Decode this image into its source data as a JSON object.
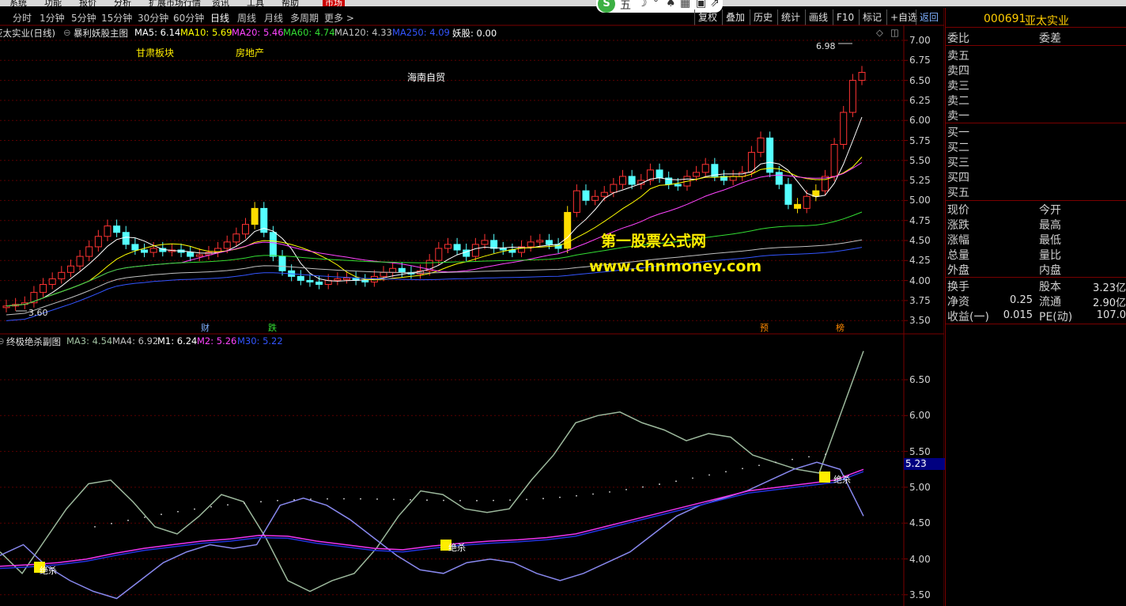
{
  "menu": {
    "items": [
      "系统",
      "功能",
      "报价",
      "分析",
      "扩展市场行情",
      "资讯",
      "工具",
      "帮助",
      "市场"
    ]
  },
  "periods": [
    "分时",
    "1分钟",
    "5分钟",
    "15分钟",
    "30分钟",
    "60分钟",
    "日线",
    "周线",
    "月线",
    "多周期",
    "更多 >"
  ],
  "active_period": "日线",
  "toolbar": [
    "复权",
    "叠加",
    "历史",
    "统计",
    "画线",
    "F10",
    "标记",
    "+自选"
  ],
  "toolbar_return": "返回",
  "search": {
    "logo": "S",
    "glyphs": [
      "五",
      "☽",
      "°",
      "♠",
      "▦",
      "▣",
      "⇗"
    ]
  },
  "main_header": {
    "title": "亚太实业(日线)",
    "formula": "暴利妖股主图",
    "ma": [
      {
        "label": "MA5: 6.14",
        "color": "#ffffff"
      },
      {
        "label": "MA10: 5.69",
        "color": "#ffff00"
      },
      {
        "label": "MA20: 5.46",
        "color": "#ff44ff"
      },
      {
        "label": "MA60: 4.74",
        "color": "#33dd33"
      },
      {
        "label": "MA120: 4.33",
        "color": "#c0c0c0"
      },
      {
        "label": "MA250: 4.09",
        "color": "#3355ff"
      },
      {
        "label": "妖股: 0.00",
        "color": "#ffffff"
      }
    ]
  },
  "annotations": {
    "board": "甘肃板块",
    "realestate": "房地产",
    "hainan": "海南自贸",
    "high": "6.98",
    "low": "3.60"
  },
  "event_tags": [
    "财",
    "跌",
    "预",
    "榜"
  ],
  "sub_header": {
    "formula": "终极绝杀副图",
    "items": [
      {
        "label": "MA3: 4.54",
        "color": "#a0c0a0"
      },
      {
        "label": "MA4: 6.92",
        "color": "#c0c0c0"
      },
      {
        "label": "M1: 6.24",
        "color": "#ffffff"
      },
      {
        "label": "M2: 5.26",
        "color": "#ff44ff"
      },
      {
        "label": "M30: 5.22",
        "color": "#3355ff"
      }
    ]
  },
  "signals": [
    "绝杀",
    "绝杀",
    "绝杀"
  ],
  "watermark": {
    "line1": "第一股票公式网",
    "line2": "www.chnmoney.com"
  },
  "main_axis": [
    "7.00",
    "6.75",
    "6.50",
    "6.25",
    "6.00",
    "5.75",
    "5.50",
    "5.25",
    "5.00",
    "4.75",
    "4.50",
    "4.25",
    "4.00",
    "3.75",
    "3.50"
  ],
  "sub_axis": [
    "6.50",
    "6.00",
    "5.50",
    "5.00",
    "4.50",
    "4.00",
    "3.50"
  ],
  "sub_axis_badge": "5.23",
  "quote": {
    "code": "000691",
    "name": "亚太实业",
    "wb_label": "委比",
    "wc_label": "委差",
    "asks": [
      "卖五",
      "卖四",
      "卖三",
      "卖二",
      "卖一"
    ],
    "bids": [
      "买一",
      "买二",
      "买三",
      "买四",
      "买五"
    ],
    "rows": [
      [
        "现价",
        "今开"
      ],
      [
        "涨跌",
        "最高"
      ],
      [
        "涨幅",
        "最低"
      ],
      [
        "总量",
        "量比"
      ],
      [
        "外盘",
        "内盘"
      ]
    ],
    "stats": [
      {
        "l": "换手",
        "m": "股本",
        "v": "3.23亿"
      },
      {
        "l": "净资",
        "lv": "0.25",
        "m": "流通",
        "v": "2.90亿"
      },
      {
        "l": "收益(一)",
        "lv": "0.015",
        "m": "PE(动)",
        "v": "107.0"
      }
    ]
  }
}
